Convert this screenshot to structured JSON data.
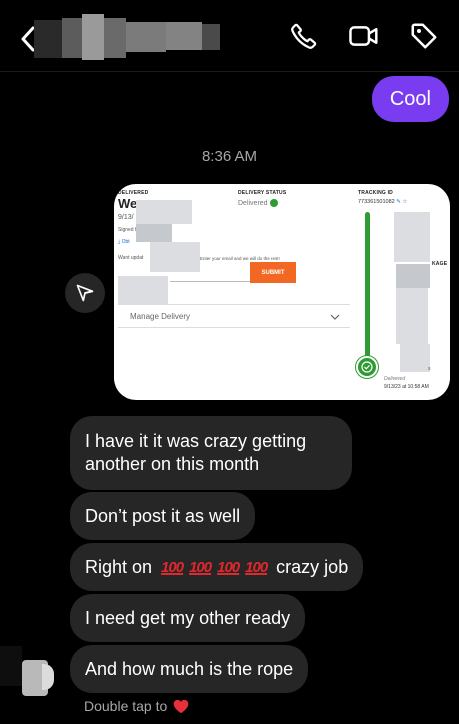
{
  "header": {
    "back_icon": "chevron-left-icon",
    "actions": [
      "phone-icon",
      "video-icon",
      "tag-icon"
    ]
  },
  "messages": {
    "outgoing": "Cool",
    "timestamp": "8:36 AM",
    "card": {
      "delivered_label": "DELIVERED",
      "title_fragment": "We",
      "date_fragment": "9/13/",
      "signed_fragment": "Signed f",
      "link_fragment": "Obt",
      "want_update_fragment": "Want updat",
      "email_prompt": "Enter your email and we will do the rest!",
      "submit_label": "SUBMIT",
      "manage_delivery": "Manage Delivery",
      "delivery_status_label": "DELIVERY STATUS",
      "delivery_status_value": "Delivered",
      "tracking_id_label": "TRACKING ID",
      "tracking_id_value": "773361501082",
      "package_fragment": "KAGE",
      "status_fragment": "s",
      "timeline_status": "Delivered",
      "timeline_date": "9/13/23 at 10:58 AM"
    },
    "incoming": [
      {
        "line1": "I have it it was crazy getting",
        "line2": "another on this month"
      },
      {
        "text": "Don’t post it as well"
      },
      {
        "prefix": "Right on",
        "emojis": [
          "100",
          "100",
          "100",
          "100"
        ],
        "suffix": "crazy job"
      },
      {
        "text": "I need get my other ready"
      },
      {
        "text": "And how much is the rope"
      }
    ],
    "double_tap_hint": "Double tap to",
    "double_tap_icon": "heart-icon"
  },
  "colors": {
    "outgoing_bubble": "#7a3cf0",
    "incoming_bubble": "#262626",
    "submit_button": "#f26722",
    "delivered_green": "#2e9b33"
  }
}
